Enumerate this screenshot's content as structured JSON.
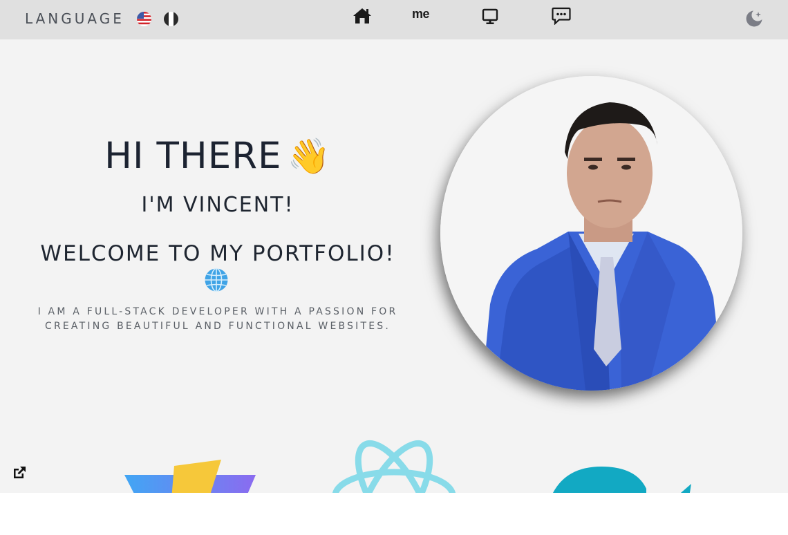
{
  "navbar": {
    "language_label": "LANGUAGE",
    "languages": [
      {
        "code": "en",
        "icon": "us-flag-icon"
      },
      {
        "code": "it",
        "icon": "italy-flag-icon"
      }
    ],
    "items": [
      {
        "name": "home",
        "icon": "home-icon"
      },
      {
        "name": "about",
        "label": "me"
      },
      {
        "name": "projects",
        "icon": "monitor-icon"
      },
      {
        "name": "contact",
        "icon": "chat-icon"
      }
    ],
    "theme_toggle_icon": "moon-icon"
  },
  "hero": {
    "greeting": "HI THERE",
    "wave_emoji": "👋",
    "name_line": "I'M VINCENT!",
    "welcome_line": "WELCOME TO MY PORTFOLIO!",
    "globe_icon": "globe-icon",
    "tagline_1": "I AM A FULL-STACK DEVELOPER WITH A PASSION FOR",
    "tagline_2": "CREATING BEAUTIFUL AND FUNCTIONAL WEBSITES."
  },
  "skills": {
    "external_link_icon": "external-link-icon",
    "logos": [
      "vite-logo",
      "react-logo",
      "tailwind-logo"
    ]
  },
  "colors": {
    "navbar_bg": "#e0e0e0",
    "hero_bg": "#f3f3f3",
    "text_dark": "#1c2331",
    "text_muted": "#5a5f66",
    "suit_blue": "#3a63d6",
    "react_cyan": "#7fd9ea",
    "tailwind_teal": "#11a8c2"
  }
}
